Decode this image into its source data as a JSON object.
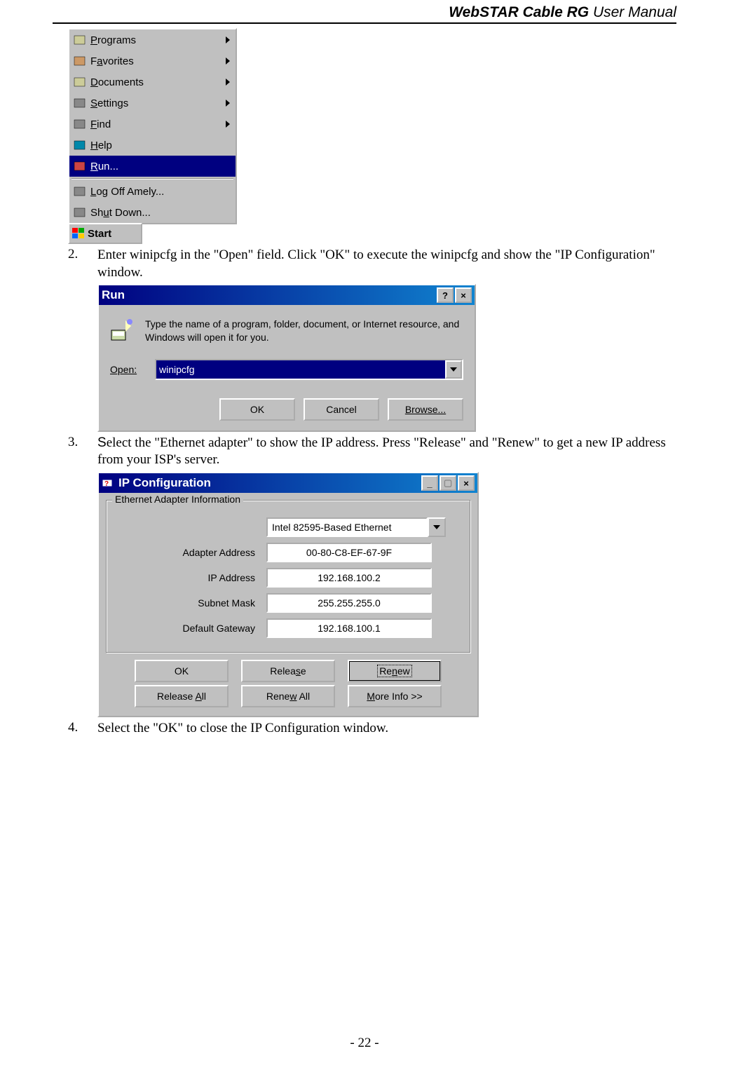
{
  "header": {
    "brand": "WebSTAR Cable RG",
    "suffix": " User Manual"
  },
  "footer": {
    "page": "- 22 -"
  },
  "startmenu": {
    "items": [
      {
        "label": "Programs",
        "u": "P",
        "arrow": true
      },
      {
        "label": "Favorites",
        "u": "a",
        "arrow": true
      },
      {
        "label": "Documents",
        "u": "D",
        "arrow": true
      },
      {
        "label": "Settings",
        "u": "S",
        "arrow": true
      },
      {
        "label": "Find",
        "u": "F",
        "arrow": true
      },
      {
        "label": "Help",
        "u": "H",
        "arrow": false
      },
      {
        "label": "Run...",
        "u": "R",
        "arrow": false,
        "selected": true
      },
      {
        "sep": true
      },
      {
        "label": "Log Off Amely...",
        "u": "L",
        "arrow": false
      },
      {
        "label": "Shut Down...",
        "u": "u",
        "arrow": false
      }
    ],
    "startLabel": "Start"
  },
  "steps": {
    "s2": {
      "num": "2.",
      "text": "Enter winipcfg in the \"Open\" field. Click \"OK\" to execute the winipcfg and show the \"IP Configuration\" window."
    },
    "s3": {
      "num": "3.",
      "text": "Select the \"Ethernet adapter\" to show the IP address. Press \"Release\" and \"Renew\" to get a new IP address from your ISP's server."
    },
    "s4": {
      "num": "4.",
      "text": "Select the \"OK\" to close the IP Configuration window."
    }
  },
  "run": {
    "title": "Run",
    "desc": "Type the name of a program, folder, document, or Internet resource, and Windows will open it for you.",
    "openLabel": "Open:",
    "value": "winipcfg",
    "ok": "OK",
    "cancel": "Cancel",
    "browse": "Browse..."
  },
  "ip": {
    "title": "IP Configuration",
    "group": "Ethernet  Adapter Information",
    "adapterSelect": "Intel 82595-Based Ethernet",
    "fields": {
      "adapterAddressLabel": "Adapter Address",
      "adapterAddress": "00-80-C8-EF-67-9F",
      "ipAddressLabel": "IP Address",
      "ipAddress": "192.168.100.2",
      "subnetLabel": "Subnet Mask",
      "subnet": "255.255.255.0",
      "gatewayLabel": "Default Gateway",
      "gateway": "192.168.100.1"
    },
    "buttons": {
      "ok": "OK",
      "release": "Release",
      "renew": "Renew",
      "releaseAll": "Release All",
      "renewAll": "Renew All",
      "more": "More Info >>"
    }
  }
}
